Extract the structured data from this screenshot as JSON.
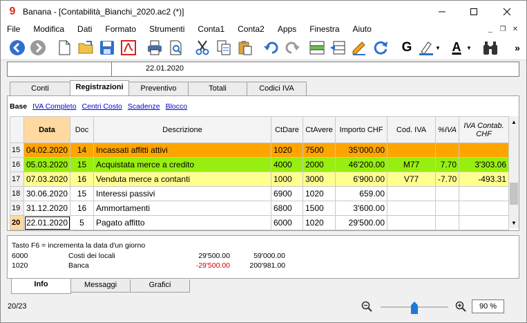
{
  "window": {
    "title": "Banana - [Contabilità_Bianchi_2020.ac2 (*)]",
    "app_icon": "banana-logo",
    "controls": [
      "minimize",
      "maximize",
      "close"
    ]
  },
  "menu": [
    "File",
    "Modifica",
    "Dati",
    "Formato",
    "Strumenti",
    "Conta1",
    "Conta2",
    "Apps",
    "Finestra",
    "Aiuto"
  ],
  "toolbar": {
    "icons": [
      "back-icon",
      "forward-icon",
      "new-file-icon",
      "open-folder-icon",
      "save-icon",
      "pdf-icon",
      "print-icon",
      "print-preview-icon",
      "cut-icon",
      "copy-icon",
      "paste-icon",
      "undo-icon",
      "redo-icon",
      "add-rows-icon",
      "delete-rows-icon",
      "edit-icon",
      "refresh-icon",
      "bold-icon",
      "highlight-icon",
      "font-color-icon",
      "binoculars-icon",
      "more-icon"
    ],
    "bold_label": "G",
    "font_color_label": "A",
    "more_label": "»"
  },
  "addressbar": {
    "value": "22.01.2020"
  },
  "tabs": [
    "Conti",
    "Registrazioni",
    "Preventivo",
    "Totali",
    "Codici IVA"
  ],
  "active_tab": "Registrazioni",
  "views": [
    "Base",
    "IVA Completo",
    "Centri Costo",
    "Scadenze",
    "Blocco"
  ],
  "table": {
    "columns": [
      "Data",
      "Doc",
      "Descrizione",
      "CtDare",
      "CtAvere",
      "Importo CHF",
      "Cod. IVA",
      "%IVA",
      "IVA Contab. CHF"
    ],
    "rows": [
      {
        "n": "15",
        "data": "04.02.2020",
        "doc": "14",
        "desc": "Incassati affitti attivi",
        "dare": "1020",
        "avere": "7500",
        "importo": "35'000.00",
        "codiva": "",
        "piva": "",
        "ivacontab": ""
      },
      {
        "n": "16",
        "data": "05.03.2020",
        "doc": "15",
        "desc": "Acquistata merce a credito",
        "dare": "4000",
        "avere": "2000",
        "importo": "46'200.00",
        "codiva": "M77",
        "piva": "7.70",
        "ivacontab": "3'303.06"
      },
      {
        "n": "17",
        "data": "07.03.2020",
        "doc": "16",
        "desc": "Venduta merce a contanti",
        "dare": "1000",
        "avere": "3000",
        "importo": "6'900.00",
        "codiva": "V77",
        "piva": "-7.70",
        "ivacontab": "-493.31"
      },
      {
        "n": "18",
        "data": "30.06.2020",
        "doc": "15",
        "desc": "Interessi passivi",
        "dare": "6900",
        "avere": "1020",
        "importo": "659.00",
        "codiva": "",
        "piva": "",
        "ivacontab": ""
      },
      {
        "n": "19",
        "data": "31.12.2020",
        "doc": "16",
        "desc": "Ammortamenti",
        "dare": "6800",
        "avere": "1500",
        "importo": "3'600.00",
        "codiva": "",
        "piva": "",
        "ivacontab": ""
      },
      {
        "n": "20",
        "data": "22.01.2020",
        "doc": "5",
        "desc": "Pagato affitto",
        "dare": "6000",
        "avere": "1020",
        "importo": "29'500.00",
        "codiva": "",
        "piva": "",
        "ivacontab": ""
      }
    ]
  },
  "info": {
    "hint": "Tasto F6 = incrementa la data d'un giorno",
    "lines": [
      {
        "account": "6000",
        "name": "Costi dei locali",
        "amount": "29'500.00",
        "balance": "59'000.00"
      },
      {
        "account": "1020",
        "name": "Banca",
        "amount": "-29'500.00",
        "balance": "200'981.00"
      }
    ]
  },
  "bottom_tabs": [
    "Info",
    "Messaggi",
    "Grafici"
  ],
  "status": {
    "position": "20/23",
    "zoom": "90 %",
    "zoom_level": 0.5
  },
  "colors": {
    "orange": "#ffa500",
    "green": "#99ee11",
    "yellow": "#ffff90",
    "negative": "#d00000"
  }
}
